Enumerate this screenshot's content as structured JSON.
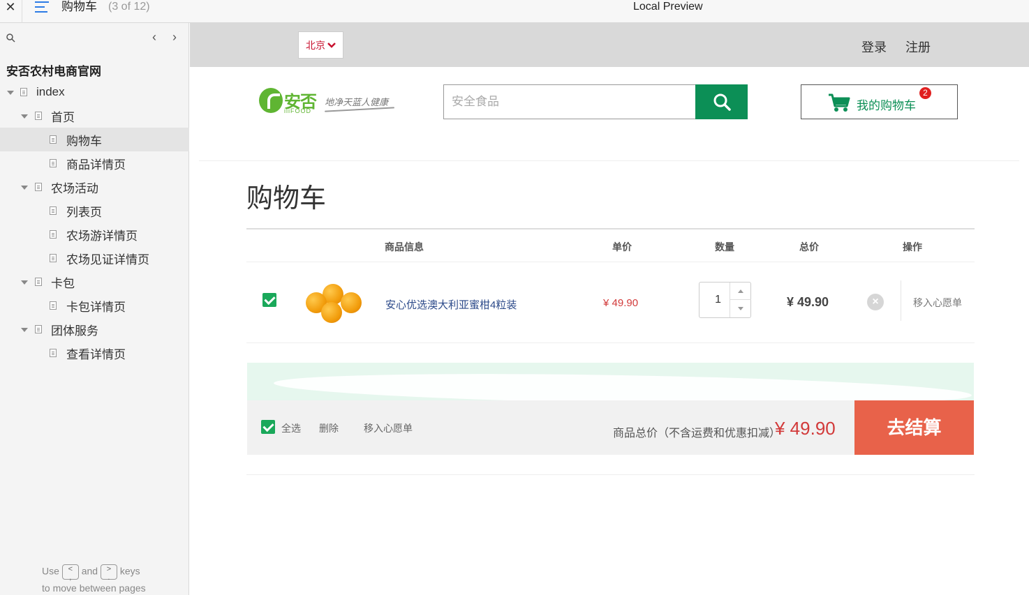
{
  "window": {
    "close_icon": "close-icon",
    "page_title": "购物车",
    "page_count": "(3 of 12)",
    "preview_label": "Local Preview"
  },
  "sidebar": {
    "project_name": "安否农村电商官网",
    "tree": [
      {
        "label": "index",
        "level": 0,
        "expanded": true,
        "selected": false
      },
      {
        "label": "首页",
        "level": 1,
        "expanded": true,
        "selected": false
      },
      {
        "label": "购物车",
        "level": 2,
        "expanded": false,
        "selected": true
      },
      {
        "label": "商品详情页",
        "level": 2,
        "expanded": false,
        "selected": false
      },
      {
        "label": "农场活动",
        "level": 1,
        "expanded": true,
        "selected": false
      },
      {
        "label": "列表页",
        "level": 2,
        "expanded": false,
        "selected": false
      },
      {
        "label": "农场游详情页",
        "level": 2,
        "expanded": false,
        "selected": false
      },
      {
        "label": "农场见证详情页",
        "level": 2,
        "expanded": false,
        "selected": false
      },
      {
        "label": "卡包",
        "level": 1,
        "expanded": true,
        "selected": false
      },
      {
        "label": "卡包详情页",
        "level": 2,
        "expanded": false,
        "selected": false
      },
      {
        "label": "团体服务",
        "level": 1,
        "expanded": true,
        "selected": false
      },
      {
        "label": "查看详情页",
        "level": 2,
        "expanded": false,
        "selected": false
      }
    ],
    "help": {
      "use": "Use",
      "and": "and",
      "keys": "keys",
      "line2": "to move between pages"
    }
  },
  "site": {
    "city": "北京",
    "login": "登录",
    "register": "注册",
    "logo_text": "安否",
    "logo_sub": "iiiFOOD",
    "slogan": "地净天蓝人健康",
    "search_placeholder": "安全食品",
    "cart_label": "我的购物车",
    "cart_count": "2",
    "accent_green": "#0c8f56",
    "accent_red": "#e8624a"
  },
  "cart": {
    "title": "购物车",
    "headers": [
      "商品信息",
      "单价",
      "数量",
      "总价",
      "操作"
    ],
    "items": [
      {
        "name": "安心优选澳大利亚蜜柑4粒装",
        "price": "¥ 49.90",
        "qty": "1",
        "total": "¥ 49.90",
        "remove": "×",
        "wishlist": "移入心愿单",
        "checked": true
      }
    ],
    "footer": {
      "select_all": "全选",
      "delete": "删除",
      "wishlist": "移入心愿单",
      "sum_label": "商品总价（不含运费和优惠扣减）",
      "sum_value": "¥ 49.90",
      "checkout": "去结算"
    }
  }
}
